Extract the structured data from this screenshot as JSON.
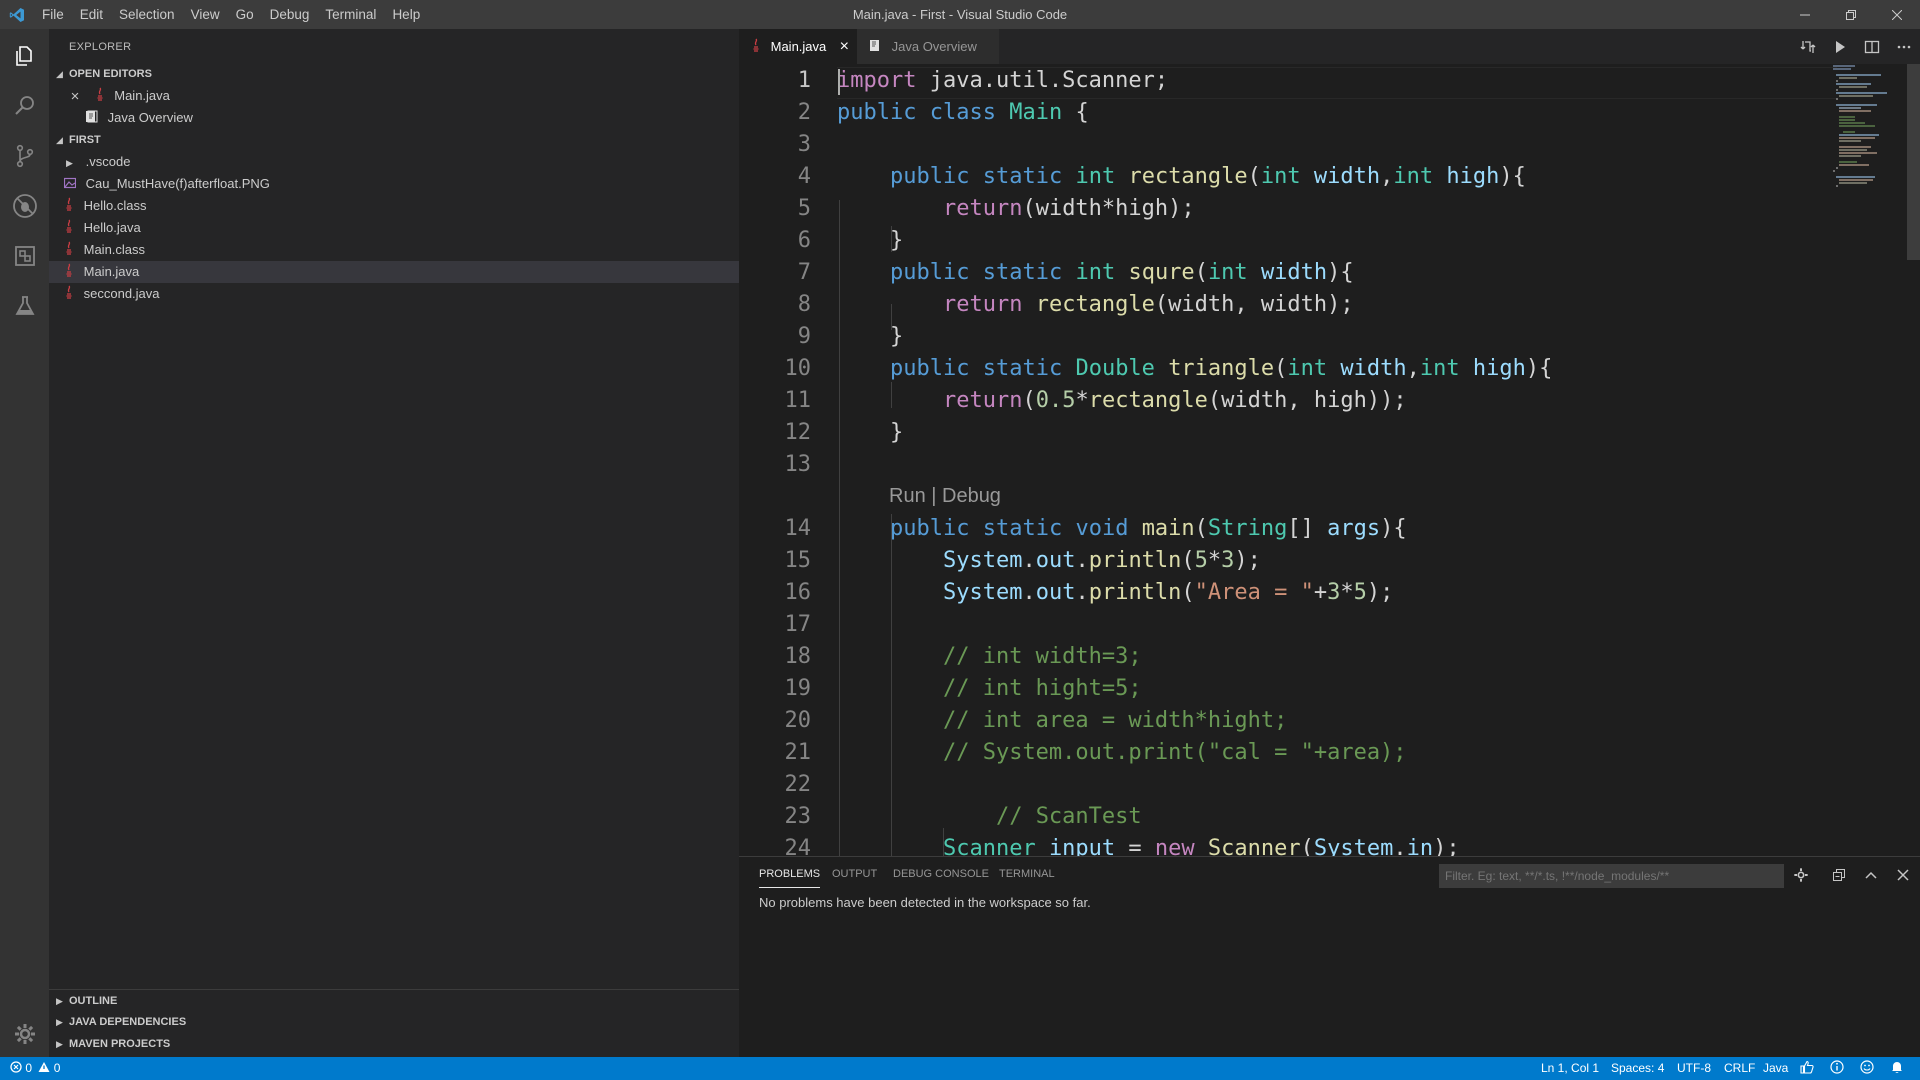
{
  "window": {
    "title": "Main.java - First - Visual Studio Code",
    "menu": [
      "File",
      "Edit",
      "Selection",
      "View",
      "Go",
      "Debug",
      "Terminal",
      "Help"
    ]
  },
  "sidebar": {
    "title": "EXPLORER",
    "open_editors": {
      "header": "OPEN EDITORS",
      "items": [
        {
          "label": "Main.java",
          "icon": "java-file-icon",
          "close": "×"
        },
        {
          "label": "Java Overview",
          "icon": "java-overview-icon"
        }
      ]
    },
    "folder": {
      "header": "FIRST",
      "items": [
        {
          "label": ".vscode",
          "type": "folder"
        },
        {
          "label": "Cau_MustHave(f)afterfloat.PNG",
          "type": "image"
        },
        {
          "label": "Hello.class",
          "type": "java"
        },
        {
          "label": "Hello.java",
          "type": "java"
        },
        {
          "label": "Main.class",
          "type": "java"
        },
        {
          "label": "Main.java",
          "type": "java",
          "selected": true
        },
        {
          "label": "seccond.java",
          "type": "java"
        }
      ]
    },
    "bottom_sections": [
      "OUTLINE",
      "JAVA DEPENDENCIES",
      "MAVEN PROJECTS"
    ]
  },
  "tabs": [
    {
      "label": "Main.java",
      "active": true,
      "close": "×"
    },
    {
      "label": "Java Overview",
      "active": false
    }
  ],
  "editor": {
    "codelens": "Run | Debug",
    "line_numbers": [
      "1",
      "2",
      "3",
      "4",
      "5",
      "6",
      "7",
      "8",
      "9",
      "10",
      "11",
      "12",
      "13",
      "14",
      "15",
      "16",
      "17",
      "18",
      "19",
      "20",
      "21",
      "22",
      "23",
      "24"
    ]
  },
  "panel": {
    "tabs": [
      "PROBLEMS",
      "OUTPUT",
      "DEBUG CONSOLE",
      "TERMINAL"
    ],
    "filter_placeholder": "Filter. Eg: text, **/*.ts, !**/node_modules/**",
    "message": "No problems have been detected in the workspace so far."
  },
  "status": {
    "errors": "0",
    "warnings": "0",
    "position": "Ln 1, Col 1",
    "spaces": "Spaces: 4",
    "encoding": "UTF-8",
    "eol": "CRLF",
    "language": "Java"
  },
  "colors": {
    "accent": "#007acc",
    "java_icon": "#cc3e44",
    "keyword": "#569cd6",
    "type": "#4ec9b0",
    "function": "#dcdcaa",
    "comment": "#6a9955"
  }
}
